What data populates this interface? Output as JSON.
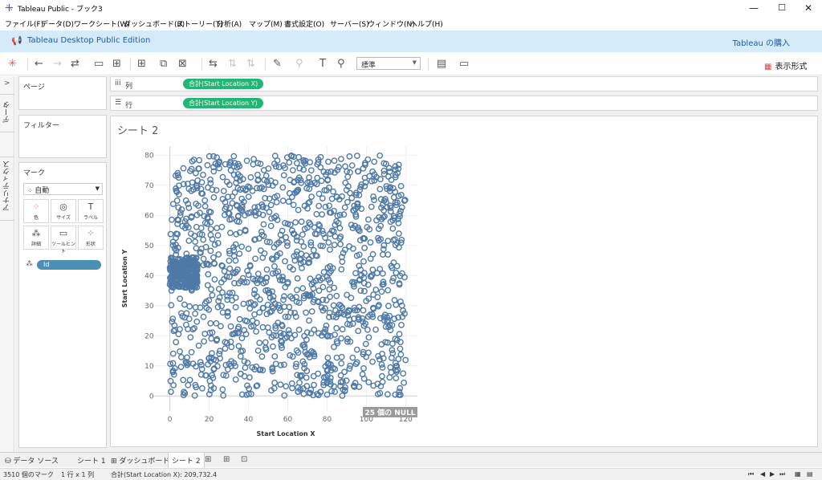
{
  "window": {
    "title": "Tableau Public - ブック3",
    "minimize": "—",
    "maximize": "☐",
    "close": "✕"
  },
  "menu": [
    "ファイル(F)",
    "データ(D)",
    "ワークシート(W)",
    "ダッシュボード(B)",
    "ストーリー(T)",
    "分析(A)",
    "マップ(M)",
    "書式設定(O)",
    "サーバー(S)",
    "ウィンドウ(N)",
    "ヘルプ(H)"
  ],
  "banner": {
    "edition": "Tableau Desktop Public Edition",
    "buy": "Tableau の購入"
  },
  "toolbar": {
    "fit": "標準",
    "show_me": "表示形式"
  },
  "side_tabs": {
    "data": "データ",
    "analytics": "アナリティクス"
  },
  "pages_card": {
    "title": "ページ"
  },
  "filters_card": {
    "title": "フィルター"
  },
  "marks_card": {
    "title": "マーク",
    "type": "自動",
    "buttons": [
      "色",
      "サイズ",
      "ラベル",
      "詳細",
      "ツールヒント",
      "形状"
    ],
    "field": "Id"
  },
  "shelves": {
    "columns": {
      "label": "列",
      "pill": "合計(Start Location X)"
    },
    "rows": {
      "label": "行",
      "pill": "合計(Start Location Y)"
    }
  },
  "sheet": {
    "title": "シート 2"
  },
  "chart_data": {
    "type": "scatter",
    "xlabel": "Start Location X",
    "ylabel": "Start Location Y",
    "xlim": [
      -8,
      126
    ],
    "ylim": [
      -5,
      83
    ],
    "x_ticks": [
      0,
      20,
      40,
      60,
      80,
      100,
      120
    ],
    "y_ticks": [
      0,
      10,
      20,
      30,
      40,
      50,
      60,
      70,
      80
    ],
    "marker": "open-circle",
    "color": "#4e79a7",
    "point_count": 3510,
    "x_range": [
      0,
      120
    ],
    "y_range": [
      0,
      80
    ],
    "null_indicator": "25 個の NULL"
  },
  "bottom_tabs": {
    "datasource": "データ ソース",
    "sheet1": "シート 1",
    "dashboard1": "ダッシュボード 1",
    "sheet2": "シート 2"
  },
  "status": {
    "marks": "3510 個のマーク",
    "rows_cols": "1 行 x 1 列",
    "sum": "合計(Start Location X): 209,732.4"
  }
}
